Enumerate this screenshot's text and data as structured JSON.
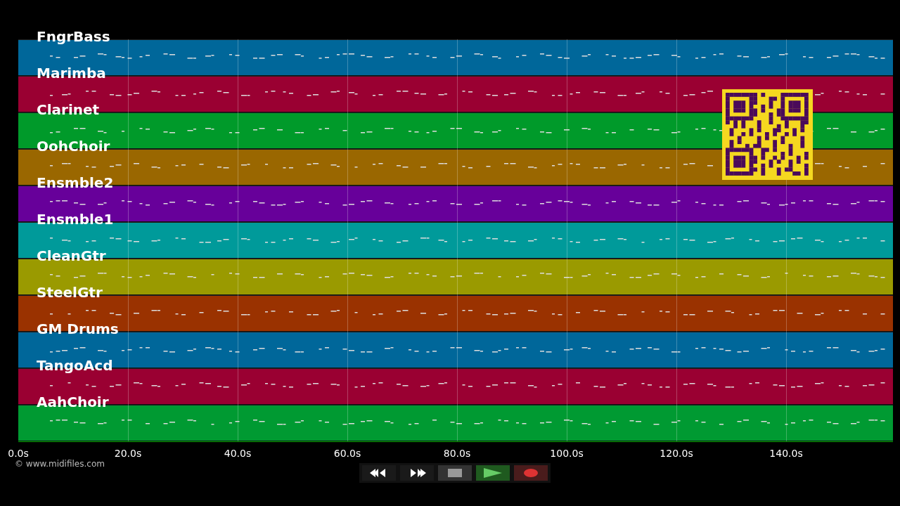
{
  "tracks": [
    {
      "name": "FngrBass",
      "color": "#00679a"
    },
    {
      "name": "Marimba",
      "color": "#9a0032"
    },
    {
      "name": "Clarinet",
      "color": "#009a2a"
    },
    {
      "name": "OohChoir",
      "color": "#9a6700"
    },
    {
      "name": "Ensmble2",
      "color": "#67009a"
    },
    {
      "name": "Ensmble1",
      "color": "#009a9a"
    },
    {
      "name": "CleanGtr",
      "color": "#9a9a00"
    },
    {
      "name": "SteelGtr",
      "color": "#9a3200"
    },
    {
      "name": "GM Drums",
      "color": "#00679a"
    },
    {
      "name": "TangoAcd",
      "color": "#9a0032"
    },
    {
      "name": "AahChoir",
      "color": "#009a32"
    }
  ],
  "axis": {
    "ticks": [
      "0.0s",
      "20.0s",
      "40.0s",
      "60.0s",
      "80.0s",
      "100.0s",
      "120.0s",
      "140.0s"
    ]
  },
  "copyright": "© www.midifiles.com",
  "transport": [
    {
      "kind": "rewind"
    },
    {
      "kind": "forward"
    },
    {
      "kind": "stop"
    },
    {
      "kind": "play"
    },
    {
      "kind": "record"
    }
  ]
}
